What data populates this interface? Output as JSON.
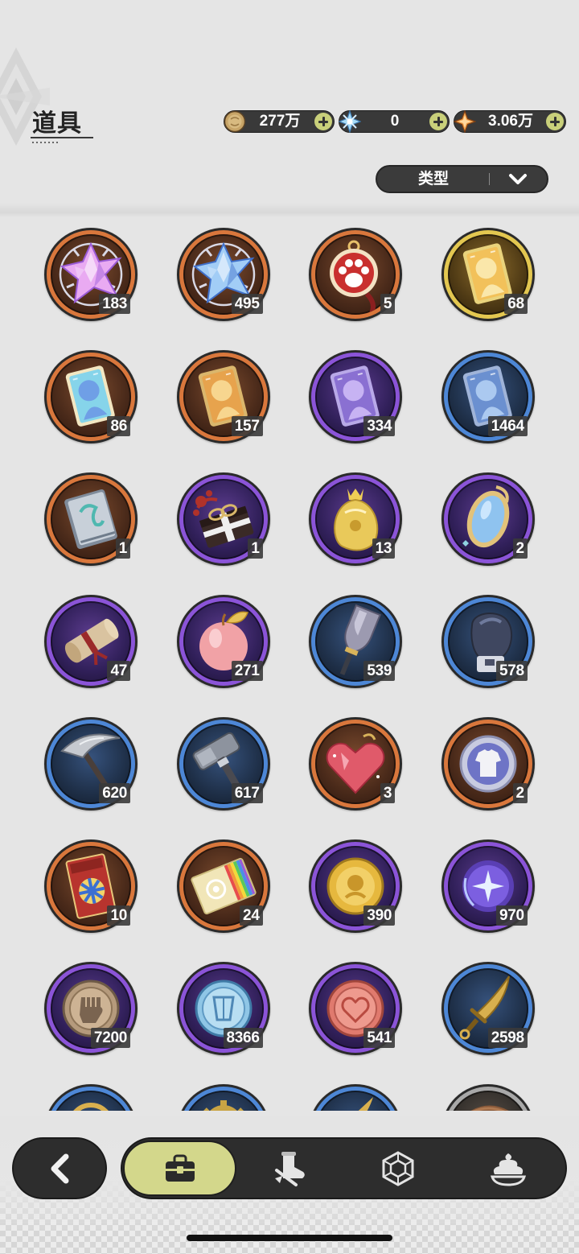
{
  "header": {
    "title": "道具"
  },
  "currencies": [
    {
      "icon": "gold-coin",
      "value": "277万"
    },
    {
      "icon": "snowflake-crystal",
      "value": "0"
    },
    {
      "icon": "orange-star",
      "value": "3.06万"
    }
  ],
  "filter": {
    "label": "类型"
  },
  "rarity_colors": {
    "orange": "#d9773c",
    "purple": "#8b54d8",
    "blue": "#4d87d6",
    "gold": "#e3c750",
    "gray": "#a8a8a8"
  },
  "items": [
    {
      "icon": "pink-crystal",
      "rarity": "orange",
      "count": "183"
    },
    {
      "icon": "blue-crystal",
      "rarity": "orange",
      "count": "495"
    },
    {
      "icon": "paw-pendant",
      "rarity": "orange",
      "count": "5"
    },
    {
      "icon": "gold-character-card",
      "rarity": "gold",
      "count": "68"
    },
    {
      "icon": "rainbow-character-card",
      "rarity": "orange",
      "count": "86"
    },
    {
      "icon": "orange-character-card",
      "rarity": "orange",
      "count": "157"
    },
    {
      "icon": "purple-character-card",
      "rarity": "purple",
      "count": "334"
    },
    {
      "icon": "blue-character-card",
      "rarity": "blue",
      "count": "1464"
    },
    {
      "icon": "rune-book",
      "rarity": "orange",
      "count": "1"
    },
    {
      "icon": "gift-box",
      "rarity": "purple",
      "count": "1"
    },
    {
      "icon": "gold-sack",
      "rarity": "purple",
      "count": "13"
    },
    {
      "icon": "magic-mirror",
      "rarity": "purple",
      "count": "2"
    },
    {
      "icon": "scroll",
      "rarity": "purple",
      "count": "47"
    },
    {
      "icon": "peach-apple",
      "rarity": "purple",
      "count": "271"
    },
    {
      "icon": "shovel",
      "rarity": "blue",
      "count": "539"
    },
    {
      "icon": "boxing-glove",
      "rarity": "blue",
      "count": "578"
    },
    {
      "icon": "pickaxe",
      "rarity": "blue",
      "count": "620"
    },
    {
      "icon": "hammer",
      "rarity": "blue",
      "count": "617"
    },
    {
      "icon": "ruby-heart",
      "rarity": "orange",
      "count": "3"
    },
    {
      "icon": "outfit-coin",
      "rarity": "orange",
      "count": "2"
    },
    {
      "icon": "wheel-ticket",
      "rarity": "orange",
      "count": "10"
    },
    {
      "icon": "rainbow-ticket",
      "rarity": "orange",
      "count": "24"
    },
    {
      "icon": "gold-coin",
      "rarity": "purple",
      "count": "390"
    },
    {
      "icon": "star-orb",
      "rarity": "purple",
      "count": "970"
    },
    {
      "icon": "fist-coin",
      "rarity": "purple",
      "count": "7200"
    },
    {
      "icon": "crystal-coin",
      "rarity": "purple",
      "count": "8366"
    },
    {
      "icon": "heart-coin",
      "rarity": "purple",
      "count": "541"
    },
    {
      "icon": "golden-dagger",
      "rarity": "blue",
      "count": "2598"
    },
    {
      "icon": "gold-ring",
      "rarity": "blue"
    },
    {
      "icon": "gold-gear",
      "rarity": "blue"
    },
    {
      "icon": "gold-blade",
      "rarity": "blue"
    },
    {
      "icon": "wooden-item",
      "rarity": "gray"
    }
  ],
  "nav": {
    "back": {
      "icon": "back-arrow"
    },
    "tabs": [
      {
        "icon": "bag",
        "selected": true
      },
      {
        "icon": "character-gear",
        "selected": false
      },
      {
        "icon": "hexagon-gem",
        "selected": false
      },
      {
        "icon": "dessert",
        "selected": false
      }
    ]
  }
}
